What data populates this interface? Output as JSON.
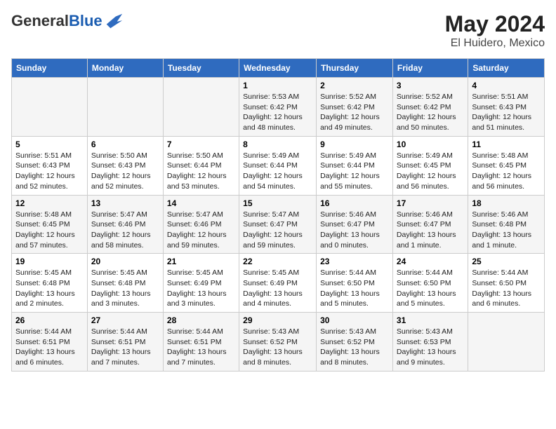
{
  "header": {
    "logo_general": "General",
    "logo_blue": "Blue",
    "month_year": "May 2024",
    "location": "El Huidero, Mexico"
  },
  "days_of_week": [
    "Sunday",
    "Monday",
    "Tuesday",
    "Wednesday",
    "Thursday",
    "Friday",
    "Saturday"
  ],
  "weeks": [
    [
      {
        "day": "",
        "info": ""
      },
      {
        "day": "",
        "info": ""
      },
      {
        "day": "",
        "info": ""
      },
      {
        "day": "1",
        "info": "Sunrise: 5:53 AM\nSunset: 6:42 PM\nDaylight: 12 hours\nand 48 minutes."
      },
      {
        "day": "2",
        "info": "Sunrise: 5:52 AM\nSunset: 6:42 PM\nDaylight: 12 hours\nand 49 minutes."
      },
      {
        "day": "3",
        "info": "Sunrise: 5:52 AM\nSunset: 6:42 PM\nDaylight: 12 hours\nand 50 minutes."
      },
      {
        "day": "4",
        "info": "Sunrise: 5:51 AM\nSunset: 6:43 PM\nDaylight: 12 hours\nand 51 minutes."
      }
    ],
    [
      {
        "day": "5",
        "info": "Sunrise: 5:51 AM\nSunset: 6:43 PM\nDaylight: 12 hours\nand 52 minutes."
      },
      {
        "day": "6",
        "info": "Sunrise: 5:50 AM\nSunset: 6:43 PM\nDaylight: 12 hours\nand 52 minutes."
      },
      {
        "day": "7",
        "info": "Sunrise: 5:50 AM\nSunset: 6:44 PM\nDaylight: 12 hours\nand 53 minutes."
      },
      {
        "day": "8",
        "info": "Sunrise: 5:49 AM\nSunset: 6:44 PM\nDaylight: 12 hours\nand 54 minutes."
      },
      {
        "day": "9",
        "info": "Sunrise: 5:49 AM\nSunset: 6:44 PM\nDaylight: 12 hours\nand 55 minutes."
      },
      {
        "day": "10",
        "info": "Sunrise: 5:49 AM\nSunset: 6:45 PM\nDaylight: 12 hours\nand 56 minutes."
      },
      {
        "day": "11",
        "info": "Sunrise: 5:48 AM\nSunset: 6:45 PM\nDaylight: 12 hours\nand 56 minutes."
      }
    ],
    [
      {
        "day": "12",
        "info": "Sunrise: 5:48 AM\nSunset: 6:45 PM\nDaylight: 12 hours\nand 57 minutes."
      },
      {
        "day": "13",
        "info": "Sunrise: 5:47 AM\nSunset: 6:46 PM\nDaylight: 12 hours\nand 58 minutes."
      },
      {
        "day": "14",
        "info": "Sunrise: 5:47 AM\nSunset: 6:46 PM\nDaylight: 12 hours\nand 59 minutes."
      },
      {
        "day": "15",
        "info": "Sunrise: 5:47 AM\nSunset: 6:47 PM\nDaylight: 12 hours\nand 59 minutes."
      },
      {
        "day": "16",
        "info": "Sunrise: 5:46 AM\nSunset: 6:47 PM\nDaylight: 13 hours\nand 0 minutes."
      },
      {
        "day": "17",
        "info": "Sunrise: 5:46 AM\nSunset: 6:47 PM\nDaylight: 13 hours\nand 1 minute."
      },
      {
        "day": "18",
        "info": "Sunrise: 5:46 AM\nSunset: 6:48 PM\nDaylight: 13 hours\nand 1 minute."
      }
    ],
    [
      {
        "day": "19",
        "info": "Sunrise: 5:45 AM\nSunset: 6:48 PM\nDaylight: 13 hours\nand 2 minutes."
      },
      {
        "day": "20",
        "info": "Sunrise: 5:45 AM\nSunset: 6:48 PM\nDaylight: 13 hours\nand 3 minutes."
      },
      {
        "day": "21",
        "info": "Sunrise: 5:45 AM\nSunset: 6:49 PM\nDaylight: 13 hours\nand 3 minutes."
      },
      {
        "day": "22",
        "info": "Sunrise: 5:45 AM\nSunset: 6:49 PM\nDaylight: 13 hours\nand 4 minutes."
      },
      {
        "day": "23",
        "info": "Sunrise: 5:44 AM\nSunset: 6:50 PM\nDaylight: 13 hours\nand 5 minutes."
      },
      {
        "day": "24",
        "info": "Sunrise: 5:44 AM\nSunset: 6:50 PM\nDaylight: 13 hours\nand 5 minutes."
      },
      {
        "day": "25",
        "info": "Sunrise: 5:44 AM\nSunset: 6:50 PM\nDaylight: 13 hours\nand 6 minutes."
      }
    ],
    [
      {
        "day": "26",
        "info": "Sunrise: 5:44 AM\nSunset: 6:51 PM\nDaylight: 13 hours\nand 6 minutes."
      },
      {
        "day": "27",
        "info": "Sunrise: 5:44 AM\nSunset: 6:51 PM\nDaylight: 13 hours\nand 7 minutes."
      },
      {
        "day": "28",
        "info": "Sunrise: 5:44 AM\nSunset: 6:51 PM\nDaylight: 13 hours\nand 7 minutes."
      },
      {
        "day": "29",
        "info": "Sunrise: 5:43 AM\nSunset: 6:52 PM\nDaylight: 13 hours\nand 8 minutes."
      },
      {
        "day": "30",
        "info": "Sunrise: 5:43 AM\nSunset: 6:52 PM\nDaylight: 13 hours\nand 8 minutes."
      },
      {
        "day": "31",
        "info": "Sunrise: 5:43 AM\nSunset: 6:53 PM\nDaylight: 13 hours\nand 9 minutes."
      },
      {
        "day": "",
        "info": ""
      }
    ]
  ]
}
